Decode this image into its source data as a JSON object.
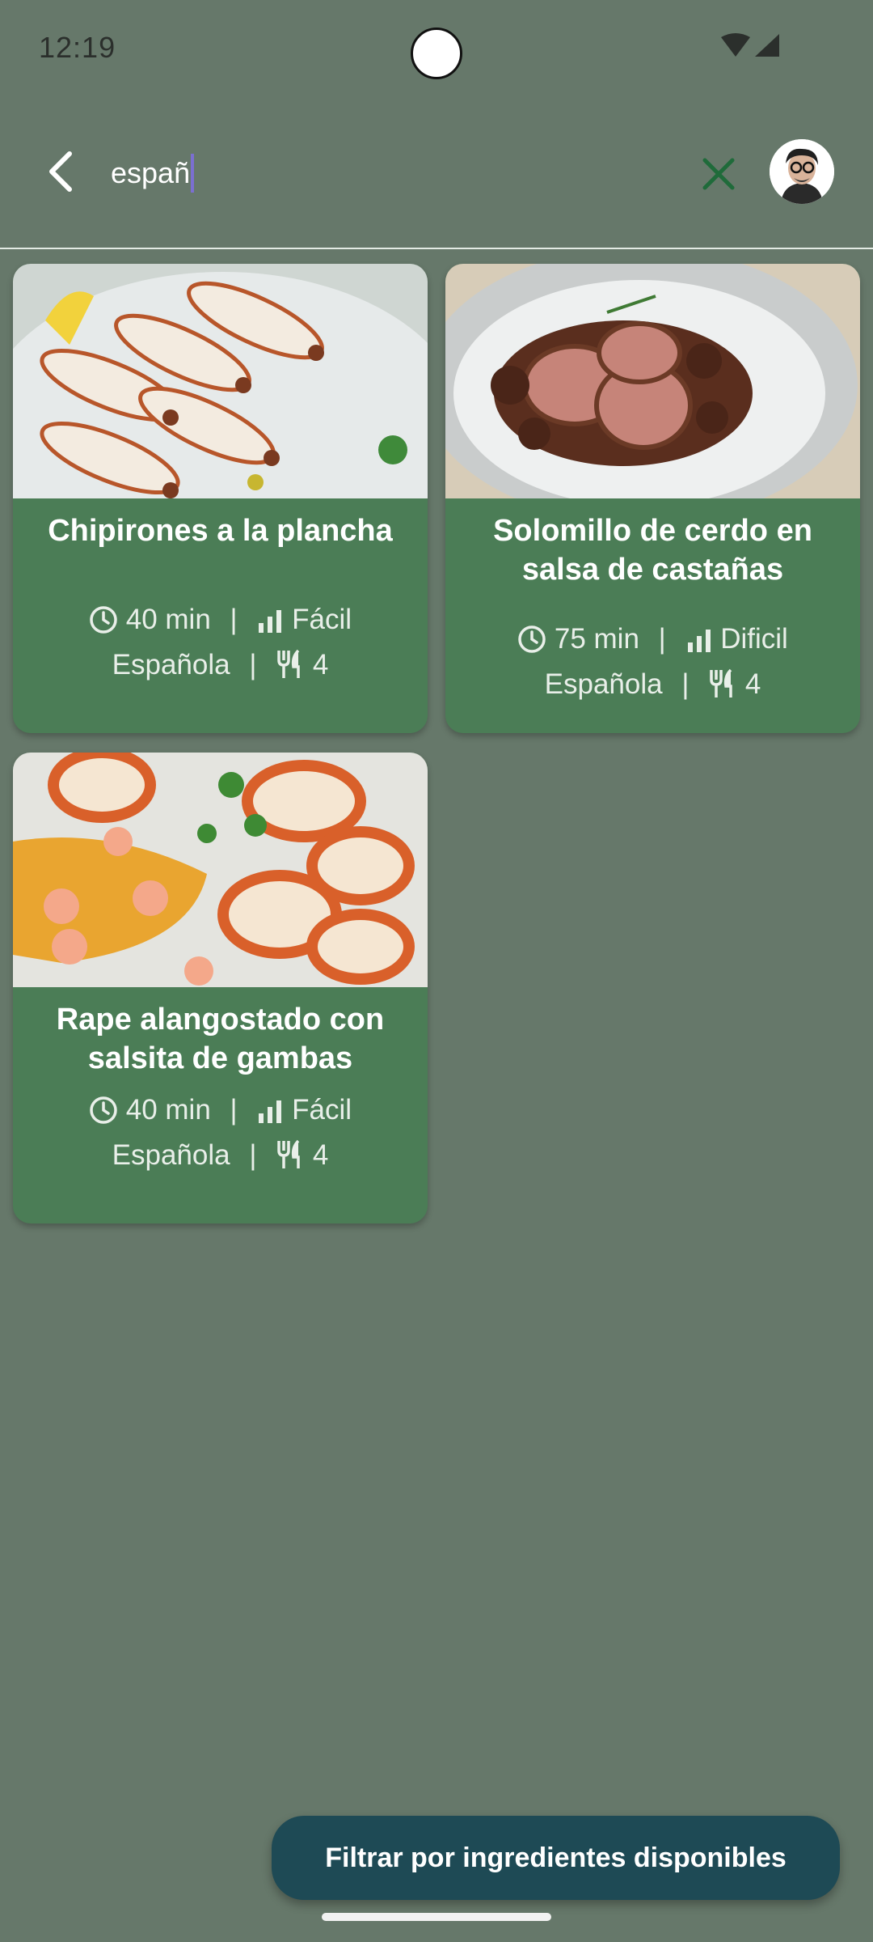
{
  "status_bar": {
    "time": "12:19"
  },
  "search": {
    "query": "españ"
  },
  "recipes": [
    {
      "title": "Chipirones a la plancha",
      "time": "40 min",
      "difficulty": "Fácil",
      "cuisine": "Española",
      "servings": "4",
      "image_icon": "grilled-squid-photo"
    },
    {
      "title": "Solomillo de cerdo en salsa de castañas",
      "time": "75 min",
      "difficulty": "Dificil",
      "cuisine": "Española",
      "servings": "4",
      "image_icon": "pork-tenderloin-photo"
    },
    {
      "title": "Rape alangostado con salsita de gambas",
      "time": "40 min",
      "difficulty": "Fácil",
      "cuisine": "Española",
      "servings": "4",
      "image_icon": "monkfish-shrimp-photo"
    }
  ],
  "filter_button": {
    "label": "Filtrar por ingredientes disponibles"
  },
  "colors": {
    "background": "#66786A",
    "card": "#4B7D56",
    "filter_button": "#1E4A55",
    "clear_icon": "#1F6B3A"
  }
}
